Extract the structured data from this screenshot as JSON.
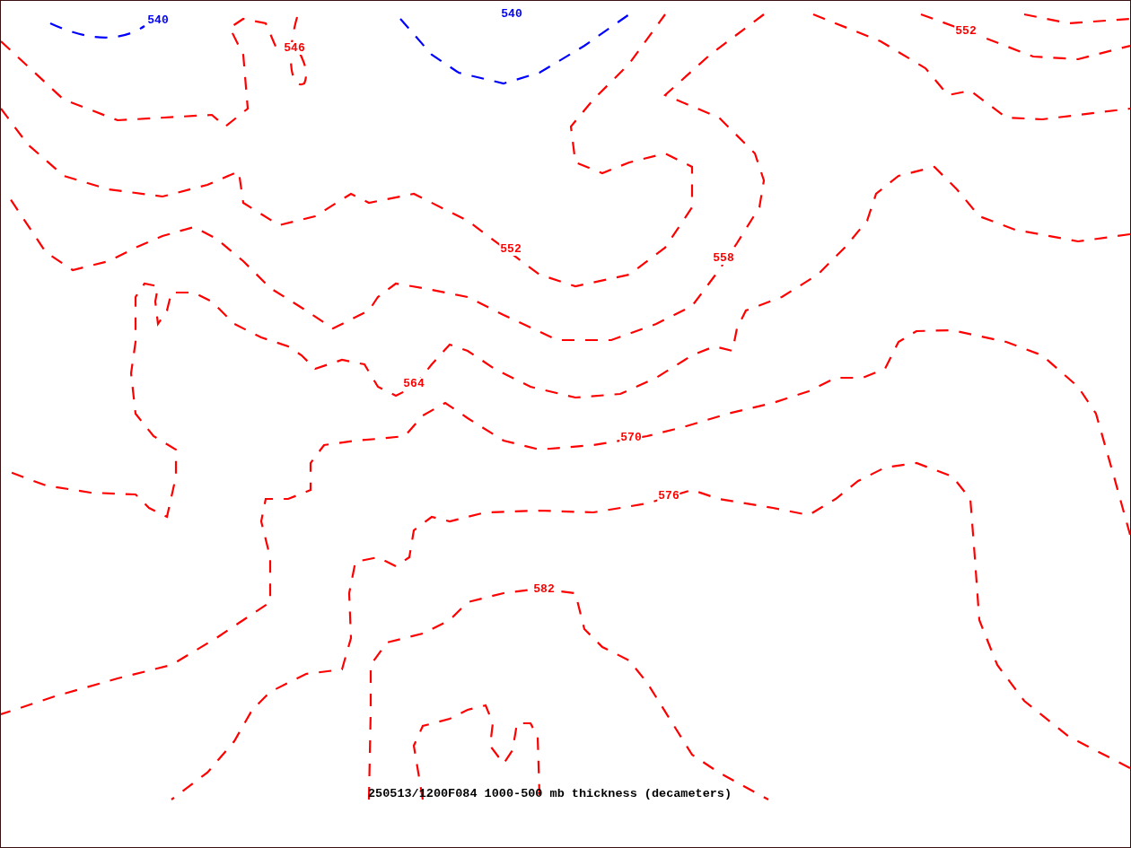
{
  "map": {
    "contour_labels": [
      {
        "text": "540",
        "color": "#0000ff"
      },
      {
        "text": "540",
        "color": "#0000ff"
      },
      {
        "text": "546",
        "color": "#ff0000"
      },
      {
        "text": "552",
        "color": "#ff0000"
      },
      {
        "text": "552",
        "color": "#ff0000"
      },
      {
        "text": "558",
        "color": "#ff0000"
      },
      {
        "text": "564",
        "color": "#ff0000"
      },
      {
        "text": "570",
        "color": "#ff0000"
      },
      {
        "text": "576",
        "color": "#ff0000"
      },
      {
        "text": "582",
        "color": "#ff0000"
      }
    ],
    "caption": "250513/1200F084 1000-500 mb thickness (decameters)"
  }
}
